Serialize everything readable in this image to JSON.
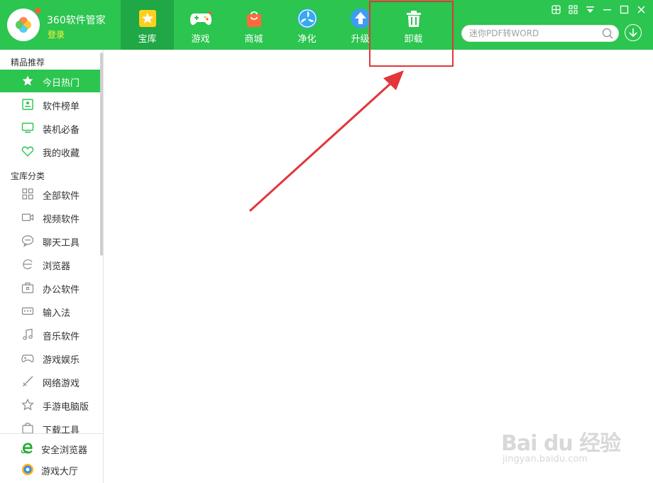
{
  "app": {
    "name": "360软件管家",
    "login_label": "登录"
  },
  "nav": {
    "tabs": [
      {
        "label": "宝库",
        "icon": "star-icon",
        "active": true
      },
      {
        "label": "游戏",
        "icon": "gamepad-icon",
        "active": false
      },
      {
        "label": "商城",
        "icon": "shopping-bag-icon",
        "active": false
      },
      {
        "label": "净化",
        "icon": "fan-icon",
        "active": false
      },
      {
        "label": "升级",
        "icon": "upgrade-arrow-icon",
        "active": false
      },
      {
        "label": "卸载",
        "icon": "trash-icon",
        "active": false
      }
    ]
  },
  "window_controls": [
    "skin-icon",
    "menu-icon",
    "dropdown-icon",
    "minimize-icon",
    "maximize-icon",
    "close-icon"
  ],
  "search": {
    "placeholder": "迷你PDF转WORD"
  },
  "sidebar": {
    "section1_title": "精品推荐",
    "section1_items": [
      {
        "label": "今日热门",
        "icon": "star-icon",
        "active": true
      },
      {
        "label": "软件榜单",
        "icon": "ranking-icon",
        "active": false
      },
      {
        "label": "装机必备",
        "icon": "monitor-icon",
        "active": false
      },
      {
        "label": "我的收藏",
        "icon": "heart-icon",
        "active": false
      }
    ],
    "section2_title": "宝库分类",
    "section2_items": [
      {
        "label": "全部软件",
        "icon": "grid-icon"
      },
      {
        "label": "视频软件",
        "icon": "video-camera-icon"
      },
      {
        "label": "聊天工具",
        "icon": "chat-bubble-icon"
      },
      {
        "label": "浏览器",
        "icon": "browser-icon"
      },
      {
        "label": "办公软件",
        "icon": "briefcase-icon"
      },
      {
        "label": "输入法",
        "icon": "keyboard-icon"
      },
      {
        "label": "音乐软件",
        "icon": "music-note-icon"
      },
      {
        "label": "游戏娱乐",
        "icon": "gamepad-outline-icon"
      },
      {
        "label": "网络游戏",
        "icon": "sword-icon"
      },
      {
        "label": "手游电脑版",
        "icon": "star-outline-icon"
      },
      {
        "label": "下载工具",
        "icon": "download-box-icon"
      }
    ],
    "bottom_links": [
      {
        "label": "安全浏览器",
        "icon": "ie-browser-icon"
      },
      {
        "label": "游戏大厅",
        "icon": "game-hall-icon"
      }
    ]
  },
  "colors": {
    "brand_green": "#2bc54f",
    "active_green": "#1fa845",
    "annotation_red": "#e2363b"
  },
  "watermark": {
    "logo_text": "Bai du 经验",
    "url": "jingyan.baidu.com"
  }
}
